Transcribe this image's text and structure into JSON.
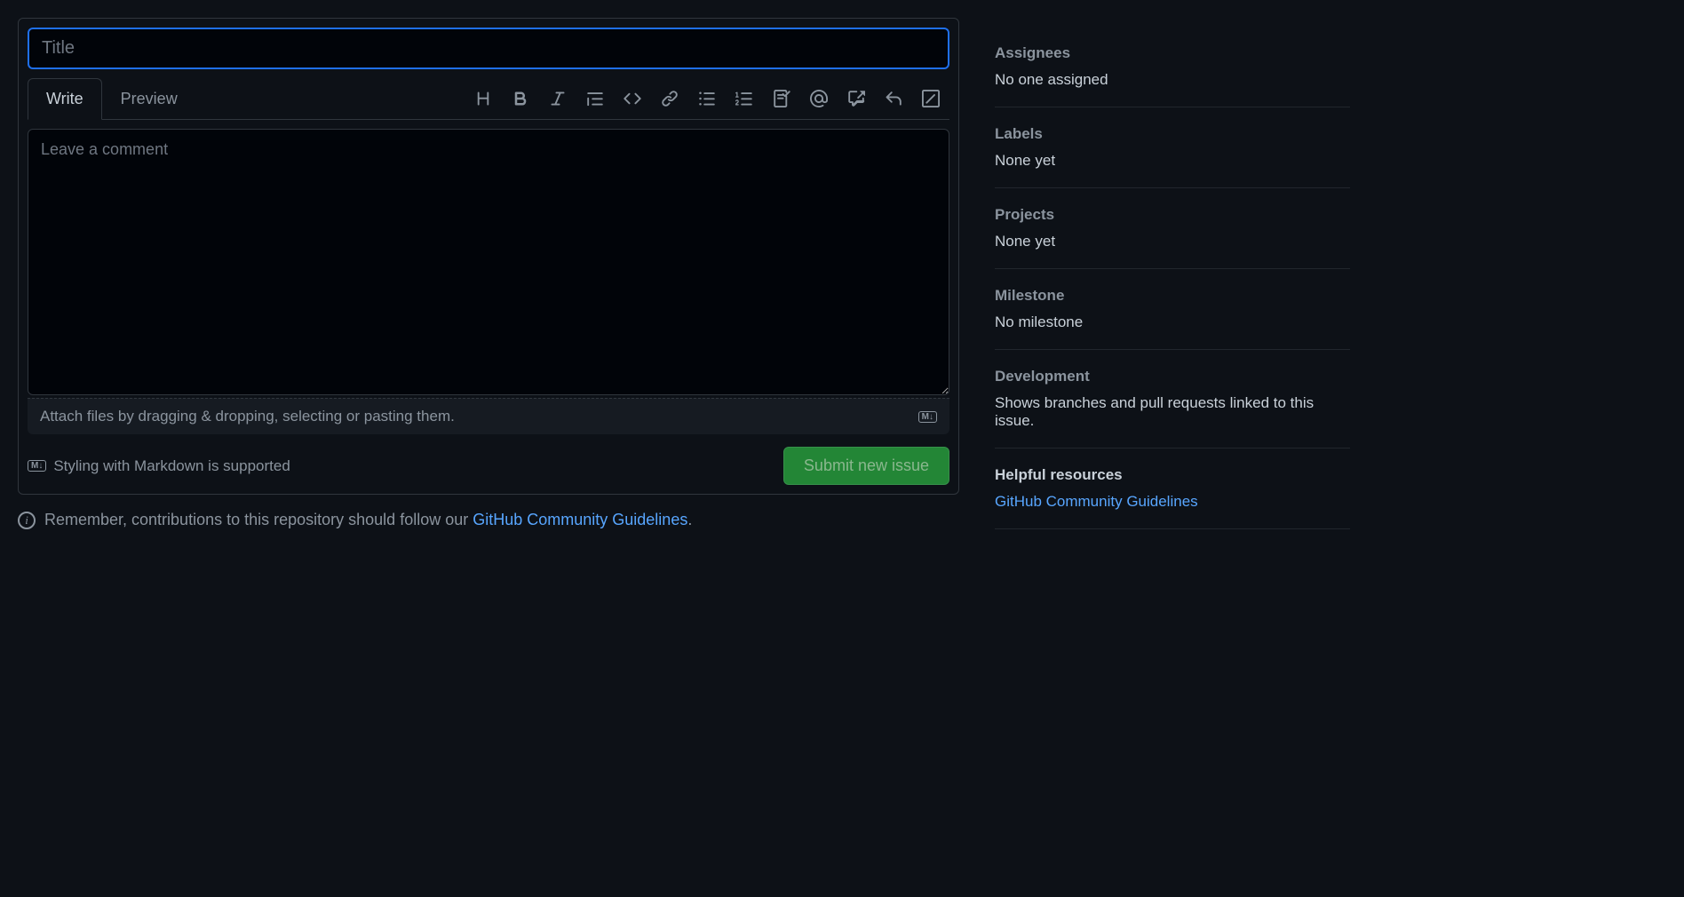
{
  "form": {
    "title_placeholder": "Title",
    "title_value": "",
    "tabs": {
      "write": "Write",
      "preview": "Preview"
    },
    "comment_placeholder": "Leave a comment",
    "comment_value": "",
    "attach_hint": "Attach files by dragging & dropping, selecting or pasting them.",
    "md_support": "Styling with Markdown is supported",
    "submit_label": "Submit new issue"
  },
  "guidelines": {
    "prefix": "Remember, contributions to this repository should follow our ",
    "link_text": "GitHub Community Guidelines",
    "suffix": "."
  },
  "sidebar": {
    "assignees": {
      "header": "Assignees",
      "value": "No one assigned"
    },
    "labels": {
      "header": "Labels",
      "value": "None yet"
    },
    "projects": {
      "header": "Projects",
      "value": "None yet"
    },
    "milestone": {
      "header": "Milestone",
      "value": "No milestone"
    },
    "development": {
      "header": "Development",
      "value": "Shows branches and pull requests linked to this issue."
    },
    "resources": {
      "header": "Helpful resources",
      "link_text": "GitHub Community Guidelines"
    }
  }
}
